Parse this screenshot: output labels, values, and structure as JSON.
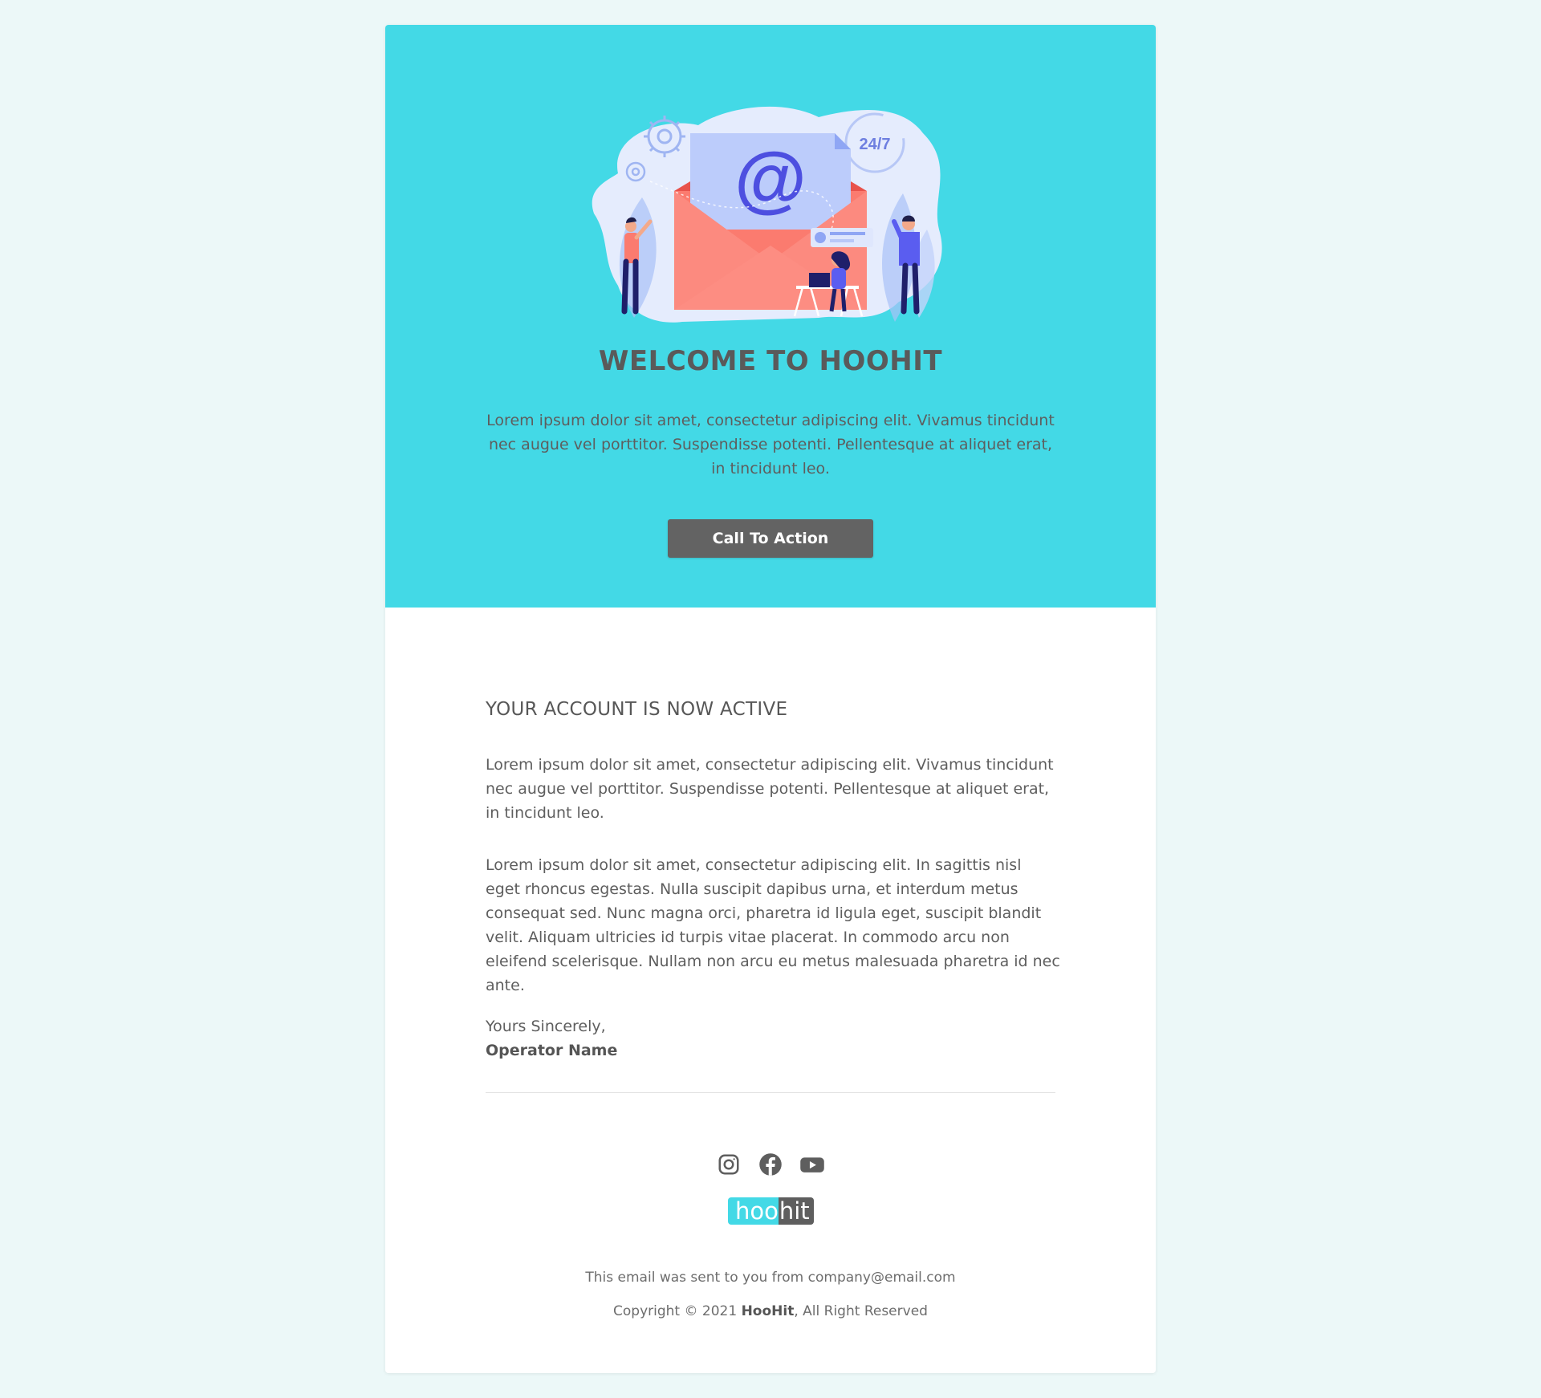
{
  "hero": {
    "badge_text": "24/7",
    "at_symbol": "@",
    "title": "WELCOME TO HOOHIT",
    "text": "Lorem ipsum dolor sit amet, consectetur adipiscing elit. Vivamus tincidunt nec augue vel porttitor. Suspendisse potenti. Pellentesque at aliquet erat, in tincidunt leo.",
    "cta_label": "Call To Action"
  },
  "content": {
    "title": "YOUR ACCOUNT IS NOW ACTIVE",
    "paragraphs": [
      "Lorem ipsum dolor sit amet, consectetur adipiscing elit. Vivamus tincidunt nec augue vel porttitor. Suspendisse potenti. Pellentesque at aliquet erat, in tincidunt leo.",
      "Lorem ipsum dolor sit amet, consectetur adipiscing elit. In sagittis nisl eget rhoncus egestas. Nulla suscipit dapibus urna, et interdum metus consequat sed. Nunc magna orci, pharetra id ligula eget, suscipit blandit velit. Aliquam ultricies id turpis vitae placerat. In commodo arcu non eleifend scelerisque. Nullam non arcu eu metus malesuada pharetra id nec ante."
    ],
    "closing": "Yours Sincerely,",
    "signature": "Operator Name"
  },
  "footer": {
    "social": [
      {
        "name": "instagram",
        "icon": "instagram-icon"
      },
      {
        "name": "facebook",
        "icon": "facebook-icon"
      },
      {
        "name": "youtube",
        "icon": "youtube-icon"
      }
    ],
    "logo_part1": "hoo",
    "logo_part2": "hit",
    "sent_text": "This email was sent to you from company@email.com",
    "copyright_prefix": "Copyright © 2021 ",
    "copyright_brand": "HooHit",
    "copyright_suffix": ", All Right Reserved"
  },
  "colors": {
    "page_bg": "#ecf8f8",
    "hero_bg": "#43d9e6",
    "button_bg": "#636363",
    "text": "#5e5e5e",
    "envelope": "#fb7b6f",
    "accent_blue": "#4d4fe0"
  }
}
